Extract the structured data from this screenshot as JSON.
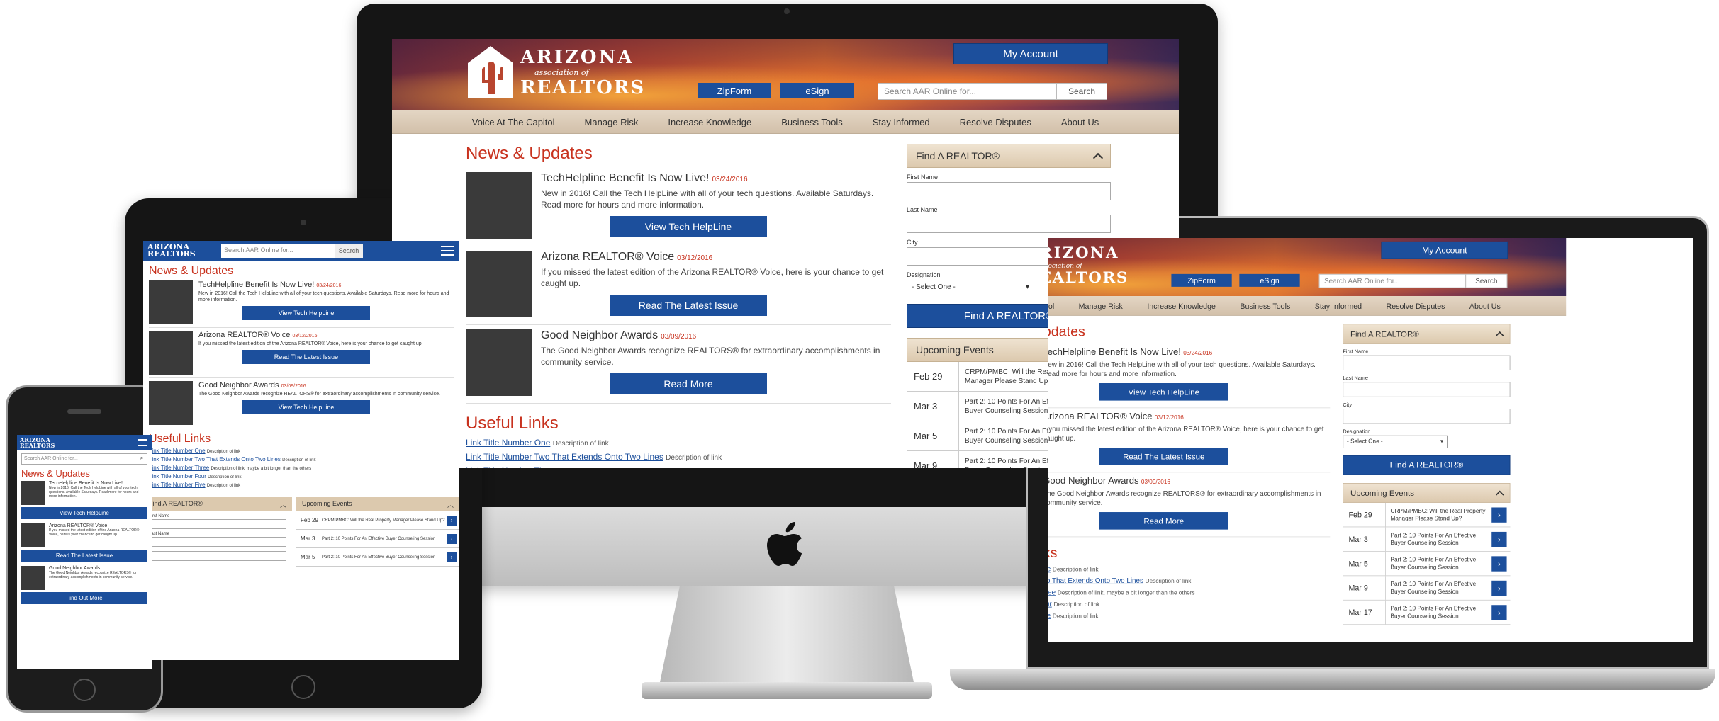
{
  "site": {
    "logo": {
      "line1": "ARIZONA",
      "line2": "association of",
      "line3": "REALTORS"
    },
    "header": {
      "my_account": "My Account",
      "zipform": "ZipForm",
      "esign": "eSign",
      "search_placeholder": "Search AAR Online for...",
      "search_button": "Search"
    },
    "nav": [
      "Voice At The Capitol",
      "Manage Risk",
      "Increase Knowledge",
      "Business Tools",
      "Stay Informed",
      "Resolve Disputes",
      "About Us"
    ],
    "news": {
      "heading": "News & Updates",
      "items": [
        {
          "title": "TechHelpline Benefit Is Now Live!",
          "date": "03/24/2016",
          "text": "New in 2016! Call the Tech HelpLine with all of your tech questions. Available Saturdays. Read more for hours and more information.",
          "button": "View Tech HelpLine"
        },
        {
          "title": "Arizona REALTOR® Voice",
          "date": "03/12/2016",
          "text": "If you missed the latest edition of the Arizona REALTOR® Voice, here is your chance to get caught up.",
          "button": "Read The Latest Issue"
        },
        {
          "title": "Good Neighbor Awards",
          "date": "03/09/2016",
          "text": "The Good Neighbor Awards recognize REALTORS® for extraordinary accomplishments in community service.",
          "button": "Read More"
        }
      ]
    },
    "useful_links": {
      "heading": "Useful Links",
      "items": [
        {
          "title": "Link Title Number One",
          "desc": "Description of link"
        },
        {
          "title": "Link Title Number Two That Extends Onto Two Lines",
          "desc": "Description of link"
        },
        {
          "title": "Link Title Number Three",
          "desc": "Description of link, maybe a bit longer than the others"
        },
        {
          "title": "Link Title Number Four",
          "desc": "Description of link"
        },
        {
          "title": "Link Title Number Five",
          "desc": "Description of link"
        }
      ]
    },
    "find_realtor": {
      "heading": "Find A REALTOR®",
      "first_name": "First Name",
      "last_name": "Last Name",
      "city": "City",
      "designation": "Designation",
      "select": "- Select One -",
      "button": "Find A REALTOR®"
    },
    "events": {
      "heading": "Upcoming Events",
      "items": [
        {
          "date": "Feb 29",
          "text": "CRPM/PMBC: Will the Real Property Manager Please Stand Up?"
        },
        {
          "date": "Mar 3",
          "text": "Part 2: 10 Points For An Effective Buyer Counseling Session"
        },
        {
          "date": "Mar 5",
          "text": "Part 2: 10 Points For An Effective Buyer Counseling Session"
        },
        {
          "date": "Mar 9",
          "text": "Part 2: 10 Points For An Effective Buyer Counseling Session"
        },
        {
          "date": "Mar 17",
          "text": "Part 2: 10 Points For An Effective Buyer Counseling Session"
        }
      ]
    },
    "phone_last_button": "Find Out More"
  },
  "colors": {
    "brand_blue": "#1c4f9c",
    "accent_red": "#c8321e",
    "panel_tan": "#dcc9ae"
  }
}
